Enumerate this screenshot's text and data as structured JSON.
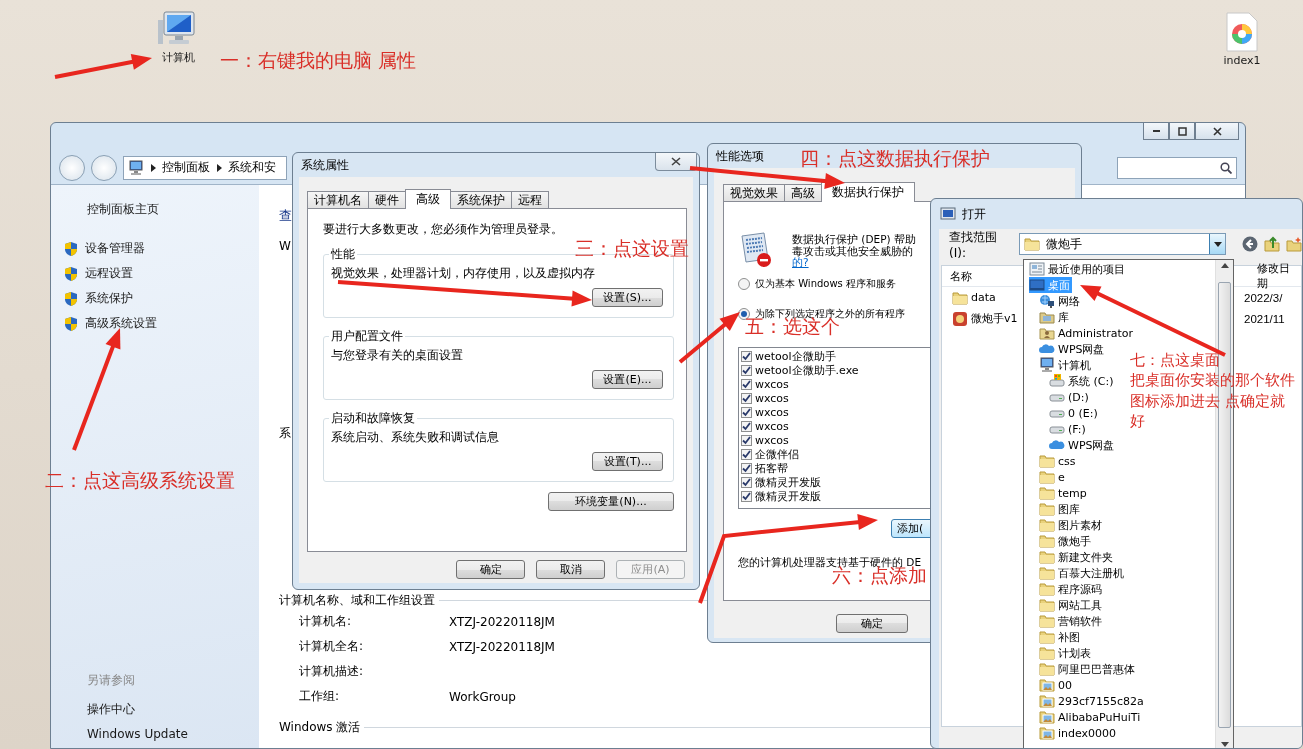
{
  "desktop_icons": [
    {
      "label": "计算机",
      "kind": "computer"
    },
    {
      "label": "index1",
      "kind": "app"
    }
  ],
  "control_panel": {
    "breadcrumb": [
      "控制面板",
      "系统和安"
    ],
    "sidebar": {
      "home": "控制面板主页",
      "links": [
        "设备管理器",
        "远程设置",
        "系统保护",
        "高级系统设置"
      ],
      "see_also_title": "另请参阅",
      "see_also": [
        "操作中心",
        "Windows Update"
      ]
    },
    "main": {
      "heading": "查",
      "line_1": "W",
      "line_2": "系",
      "section": "计算机名称、域和工作组设置",
      "rows": [
        {
          "label": "计算机名:",
          "value": "XTZJ-20220118JM"
        },
        {
          "label": "计算机全名:",
          "value": "XTZJ-20220118JM"
        },
        {
          "label": "计算机描述:"
        },
        {
          "label": "工作组:",
          "value": "WorkGroup"
        }
      ],
      "section_2": "Windows 激活"
    }
  },
  "system_properties": {
    "title": "系统属性",
    "tabs": [
      {
        "label": "计算机名",
        "selected": false
      },
      {
        "label": "硬件",
        "selected": false
      },
      {
        "label": "高级",
        "selected": true
      },
      {
        "label": "系统保护",
        "selected": false
      },
      {
        "label": "远程",
        "selected": false
      }
    ],
    "notice": "要进行大多数更改，您必须作为管理员登录。",
    "groups": [
      {
        "title": "性能",
        "text": "视觉效果，处理器计划，内存使用，以及虚拟内存",
        "button": "设置(S)..."
      },
      {
        "title": "用户配置文件",
        "text": "与您登录有关的桌面设置",
        "button": "设置(E)..."
      },
      {
        "title": "启动和故障恢复",
        "text": "系统启动、系统失败和调试信息",
        "button": "设置(T)..."
      }
    ],
    "env_button": "环境变量(N)...",
    "buttons": [
      {
        "label": "确定",
        "disabled": false
      },
      {
        "label": "取消",
        "disabled": false
      },
      {
        "label": "应用(A)",
        "disabled": true
      }
    ]
  },
  "performance_options": {
    "title": "性能选项",
    "tabs": [
      {
        "label": "视觉效果",
        "selected": false
      },
      {
        "label": "高级",
        "selected": false
      },
      {
        "label": "数据执行保护",
        "selected": true
      }
    ],
    "description": [
      "数据执行保护 (DEP) 帮助",
      "毒攻击或其他安全威胁的"
    ],
    "link": "的?",
    "radios": [
      {
        "label": "仅为基本 Windows 程序和服务",
        "selected": false
      },
      {
        "label": "为除下列选定程序之外的所有程序",
        "selected": true
      }
    ],
    "programs": [
      {
        "name": "wetool企微助手",
        "checked": true
      },
      {
        "name": "wetool企微助手.exe",
        "checked": true
      },
      {
        "name": "wxcos",
        "checked": true
      },
      {
        "name": "wxcos",
        "checked": true
      },
      {
        "name": "wxcos",
        "checked": true
      },
      {
        "name": "wxcos",
        "checked": true
      },
      {
        "name": "wxcos",
        "checked": true
      },
      {
        "name": "企微伴侣",
        "checked": true
      },
      {
        "name": "拓客帮",
        "checked": true
      },
      {
        "name": "微精灵开发版",
        "checked": true
      },
      {
        "name": "微精灵开发版",
        "checked": true
      }
    ],
    "add_button": "添加(",
    "footer": "您的计算机处理器支持基于硬件的 DE",
    "ok_button": "确定"
  },
  "open_dialog": {
    "title": "打开",
    "look_in_label": "查找范围(I):",
    "look_in_value": "微炮手",
    "columns": [
      "名称",
      "修改日期"
    ],
    "files": [
      {
        "name": "data",
        "date": "2022/3/",
        "kind": "folder"
      },
      {
        "name": "微炮手v1",
        "date": "2021/11",
        "kind": "app"
      }
    ],
    "dropdown": [
      {
        "label": "最近使用的项目",
        "kind": "recent",
        "selected": false
      },
      {
        "label": "桌面",
        "kind": "desktop",
        "selected": true,
        "children": [
          {
            "label": "网络",
            "kind": "network",
            "selected": false
          },
          {
            "label": "库",
            "kind": "library",
            "selected": false
          },
          {
            "label": "Administrator",
            "kind": "user",
            "selected": false
          },
          {
            "label": "WPS网盘",
            "kind": "cloud",
            "selected": false
          },
          {
            "label": "计算机",
            "kind": "computer",
            "selected": false,
            "children": [
              {
                "label": "系统 (C:)",
                "kind": "system-drive",
                "selected": false
              },
              {
                "label": "(D:)",
                "kind": "drive",
                "selected": false
              },
              {
                "label": "0 (E:)",
                "kind": "drive",
                "selected": false
              },
              {
                "label": "(F:)",
                "kind": "drive",
                "selected": false
              },
              {
                "label": "WPS网盘",
                "kind": "cloud",
                "selected": false
              }
            ]
          },
          {
            "label": "css",
            "kind": "folder",
            "selected": false
          },
          {
            "label": "e",
            "kind": "folder",
            "selected": false
          },
          {
            "label": "temp",
            "kind": "folder",
            "selected": false
          },
          {
            "label": "图库",
            "kind": "folder",
            "selected": false
          },
          {
            "label": "图片素材",
            "kind": "folder",
            "selected": false
          },
          {
            "label": "微炮手",
            "kind": "folder",
            "selected": false
          },
          {
            "label": "新建文件夹",
            "kind": "folder",
            "selected": false
          },
          {
            "label": "百慕大注册机",
            "kind": "folder",
            "selected": false
          },
          {
            "label": "程序源码",
            "kind": "folder",
            "selected": false
          },
          {
            "label": "网站工具",
            "kind": "folder",
            "selected": false
          },
          {
            "label": "营销软件",
            "kind": "folder",
            "selected": false
          },
          {
            "label": "补图",
            "kind": "folder",
            "selected": false
          },
          {
            "label": "计划表",
            "kind": "folder",
            "selected": false
          },
          {
            "label": "阿里巴巴普惠体",
            "kind": "folder",
            "selected": false
          },
          {
            "label": "00",
            "kind": "image-folder",
            "selected": false
          },
          {
            "label": "293cf7155c82a",
            "kind": "image-folder",
            "selected": false
          },
          {
            "label": "AlibabaPuHuiTi",
            "kind": "image-folder",
            "selected": false
          },
          {
            "label": "index0000",
            "kind": "image-folder",
            "selected": false
          }
        ]
      }
    ]
  },
  "annotations": [
    {
      "lines": [
        "一：右键我的电脑 属性"
      ]
    },
    {
      "lines": [
        "二：点这高级系统设置"
      ]
    },
    {
      "lines": [
        "三：点这设置"
      ]
    },
    {
      "lines": [
        "四：点这数据执行保护"
      ]
    },
    {
      "lines": [
        "五：选这个"
      ]
    },
    {
      "lines": [
        "六：点添加"
      ]
    },
    {
      "lines": [
        "七：点这桌面",
        "把桌面你安装的那个软件",
        "图标添加进去 点确定就",
        "好"
      ]
    }
  ]
}
